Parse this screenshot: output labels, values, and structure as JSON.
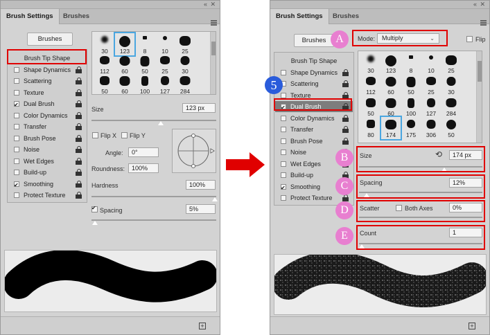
{
  "left": {
    "tabs": [
      "Brush Settings",
      "Brushes"
    ],
    "brushes_button": "Brushes",
    "list": [
      {
        "label": "Brush Tip Shape",
        "head": true
      },
      {
        "label": "Shape Dynamics",
        "checked": false
      },
      {
        "label": "Scattering",
        "checked": false
      },
      {
        "label": "Texture",
        "checked": false
      },
      {
        "label": "Dual Brush",
        "checked": true
      },
      {
        "label": "Color Dynamics",
        "checked": false
      },
      {
        "label": "Transfer",
        "checked": false
      },
      {
        "label": "Brush Pose",
        "checked": false
      },
      {
        "label": "Noise",
        "checked": false
      },
      {
        "label": "Wet Edges",
        "checked": false
      },
      {
        "label": "Build-up",
        "checked": false
      },
      {
        "label": "Smoothing",
        "checked": true
      },
      {
        "label": "Protect Texture",
        "checked": false
      }
    ],
    "presets": [
      "30",
      "123",
      "8",
      "10",
      "25",
      "112",
      "60",
      "50",
      "25",
      "30",
      "50",
      "60",
      "100",
      "127",
      "284"
    ],
    "size_label": "Size",
    "size_value": "123 px",
    "flip_x": "Flip X",
    "flip_y": "Flip Y",
    "angle_label": "Angle:",
    "angle_value": "0°",
    "roundness_label": "Roundness:",
    "roundness_value": "100%",
    "hardness_label": "Hardness",
    "hardness_value": "100%",
    "spacing_label": "Spacing",
    "spacing_value": "5%"
  },
  "right": {
    "tabs": [
      "Brush Settings",
      "Brushes"
    ],
    "brushes_button": "Brushes",
    "mode_label": "Mode:",
    "mode_value": "Multiply",
    "flip_label": "Flip",
    "list": [
      {
        "label": "Brush Tip Shape",
        "head": true
      },
      {
        "label": "Shape Dynamics",
        "checked": false
      },
      {
        "label": "Scattering",
        "checked": false
      },
      {
        "label": "Texture",
        "checked": false
      },
      {
        "label": "Dual Brush",
        "checked": true
      },
      {
        "label": "Color Dynamics",
        "checked": false
      },
      {
        "label": "Transfer",
        "checked": false
      },
      {
        "label": "Brush Pose",
        "checked": false
      },
      {
        "label": "Noise",
        "checked": false
      },
      {
        "label": "Wet Edges",
        "checked": false
      },
      {
        "label": "Build-up",
        "checked": false
      },
      {
        "label": "Smoothing",
        "checked": true
      },
      {
        "label": "Protect Texture",
        "checked": false
      }
    ],
    "presets": [
      "30",
      "123",
      "8",
      "10",
      "25",
      "112",
      "60",
      "50",
      "25",
      "30",
      "50",
      "60",
      "100",
      "127",
      "284",
      "80",
      "174",
      "175",
      "306",
      "50"
    ],
    "size_label": "Size",
    "size_value": "174 px",
    "spacing_label": "Spacing",
    "spacing_value": "12%",
    "scatter_label": "Scatter",
    "both_axes_label": "Both Axes",
    "scatter_value": "0%",
    "count_label": "Count",
    "count_value": "1"
  },
  "badges": [
    "A",
    "B",
    "C",
    "D",
    "E",
    "5"
  ],
  "colors": {
    "highlight": "#e00000",
    "badge": "#e87fd0",
    "step_badge": "#2a5cdb",
    "arrow": "#e00000"
  }
}
